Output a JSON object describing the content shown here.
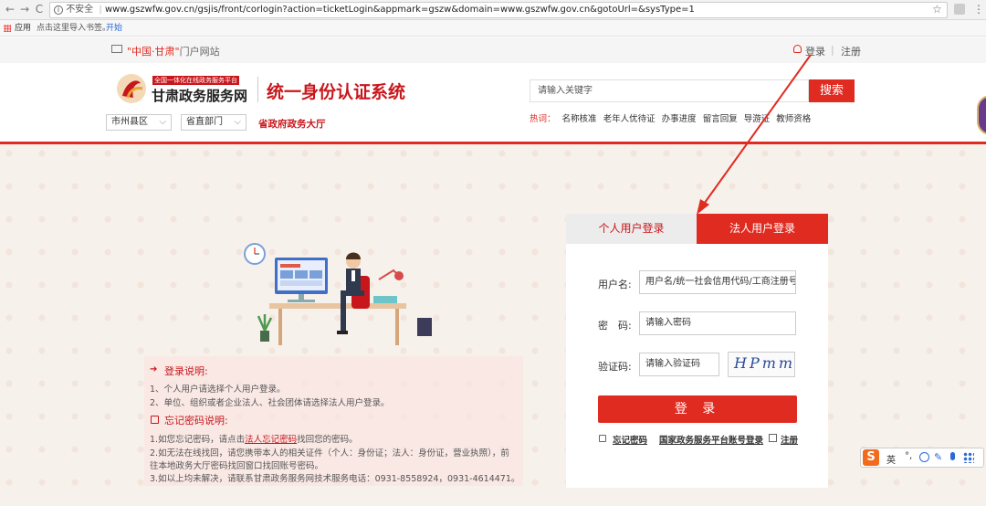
{
  "browser": {
    "back": "←",
    "forward": "→",
    "reload": "C",
    "insecure": "不安全",
    "url": "www.gszwfw.gov.cn/gsjis/front/corlogin?action=ticketLogin&appmark=gszw&domain=www.gszwfw.gov.cn&gotoUrl=&sysType=1",
    "star": "☆",
    "bookmarks": {
      "apps": "应用",
      "hint": "点击这里导入书签。",
      "start": "开始"
    }
  },
  "topstrip": {
    "portal_part1": "\"中国·甘肃\"",
    "portal_part2": "门户网站",
    "login": "登录",
    "sep": "|",
    "register": "注册"
  },
  "header": {
    "logo_tag": "全国一体化在线政务服务平台",
    "logo_name": "甘肃政务服务网",
    "system_title": "统一身份认证系统",
    "select_city": "市州县区",
    "select_dept": "省直部门",
    "province_hall": "省政府政务大厅",
    "search_placeholder": "请输入关键字",
    "search_button": "搜索",
    "hot_label": "热词：",
    "hot_words": [
      "名称核准",
      "老年人优待证",
      "办事进度",
      "留言回复",
      "导游证",
      "教师资格"
    ]
  },
  "login": {
    "tab_personal": "个人用户登录",
    "tab_legal": "法人用户登录",
    "username_label": "用户名:",
    "username_placeholder": "用户名/统一社会信用代码/工商注册号",
    "password_label": "密　码:",
    "password_placeholder": "请输入密码",
    "captcha_label": "验证码:",
    "captcha_placeholder": "请输入验证码",
    "captcha_text": "HPmm",
    "login_button": "登 录",
    "forgot": "忘记密码",
    "national_login": "国家政务服务平台账号登录",
    "register": "注册"
  },
  "info": {
    "login_title": "登录说明:",
    "login_lines": [
      "1、个人用户请选择个人用户登录。",
      "2、单位、组织或者企业法人、社会团体请选择法人用户登录。"
    ],
    "forgot_title": "忘记密码说明:",
    "forgot_line1_pre": "1.如您忘记密码，请点击",
    "forgot_line1_link": "法人忘记密码",
    "forgot_line1_post": "找回您的密码。",
    "forgot_line2a": "2.如无法在线找回，请您携带本人的相关证件（个人：身份证；法人：身份证，营业执照），前",
    "forgot_line2b": "往本地政务大厅密码找回窗口找回账号密码。",
    "forgot_line3": "3.如以上均未解决，请联系甘肃政务服务网技术服务电话：0931-8558924，0931-4614471。"
  },
  "ime": {
    "logo": "S",
    "lang": "英"
  },
  "colors": {
    "brand_red": "#e02b21",
    "bg": "#f7f1ec"
  }
}
